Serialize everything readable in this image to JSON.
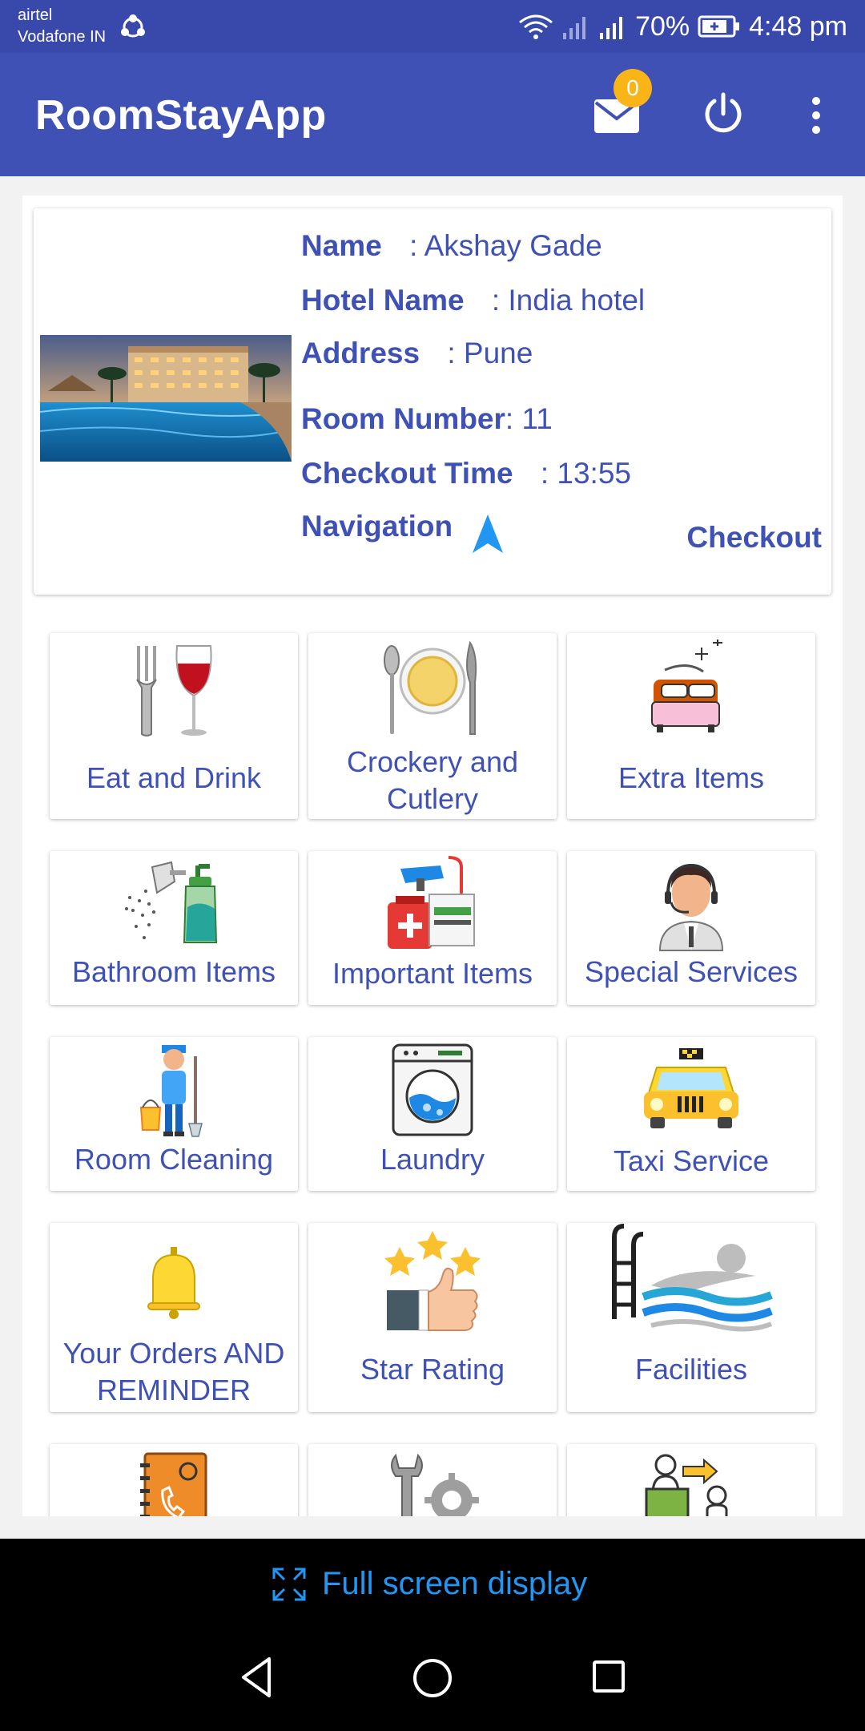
{
  "status_bar": {
    "carrier_line1": "airtel",
    "carrier_line2": "Vodafone IN",
    "battery": "70%",
    "time": "4:48 pm"
  },
  "app_bar": {
    "title": "RoomStayApp",
    "mail_badge": "0",
    "icons": [
      "mail-icon",
      "power-icon",
      "more-vert-icon"
    ]
  },
  "profile": {
    "name_label": "Name",
    "name_value": ": Akshay Gade",
    "hotel_label": "Hotel Name",
    "hotel_value": ": India hotel",
    "address_label": "Address",
    "address_value": ": Pune",
    "room_label": "Room Number",
    "room_value": ": 11",
    "checkout_time_label": "Checkout Time",
    "checkout_time_value": ": 13:55",
    "navigation_label": "Navigation",
    "checkout_button": "Checkout"
  },
  "tiles": [
    {
      "label": "Eat and Drink",
      "icon": "fork-wine-icon"
    },
    {
      "label": "Crockery and Cutlery",
      "icon": "plate-cutlery-icon"
    },
    {
      "label": "Extra Items",
      "icon": "bed-icon"
    },
    {
      "label": "Bathroom Items",
      "icon": "shower-icon"
    },
    {
      "label": "Important Items",
      "icon": "stationery-firstaid-icon"
    },
    {
      "label": "Special Services",
      "icon": "support-agent-icon"
    },
    {
      "label": "Room Cleaning",
      "icon": "cleaner-icon"
    },
    {
      "label": "Laundry",
      "icon": "washing-machine-icon"
    },
    {
      "label": "Taxi Service",
      "icon": "taxi-icon"
    },
    {
      "label": "Your Orders AND REMINDER",
      "icon": "bell-icon"
    },
    {
      "label": "Star Rating",
      "icon": "stars-thumbs-up-icon"
    },
    {
      "label": "Facilities",
      "icon": "swimming-pool-icon"
    },
    {
      "label": "",
      "icon": "phone-directory-icon"
    },
    {
      "label": "",
      "icon": "tools-icon"
    },
    {
      "label": "",
      "icon": "reception-icon"
    }
  ],
  "full_screen": {
    "label": "Full screen display"
  },
  "colors": {
    "status_bar": "#3949ab",
    "app_bar": "#3f51b5",
    "text_primary": "#3f51b5",
    "badge": "#f9b418",
    "nav_arrow": "#2196f3"
  }
}
